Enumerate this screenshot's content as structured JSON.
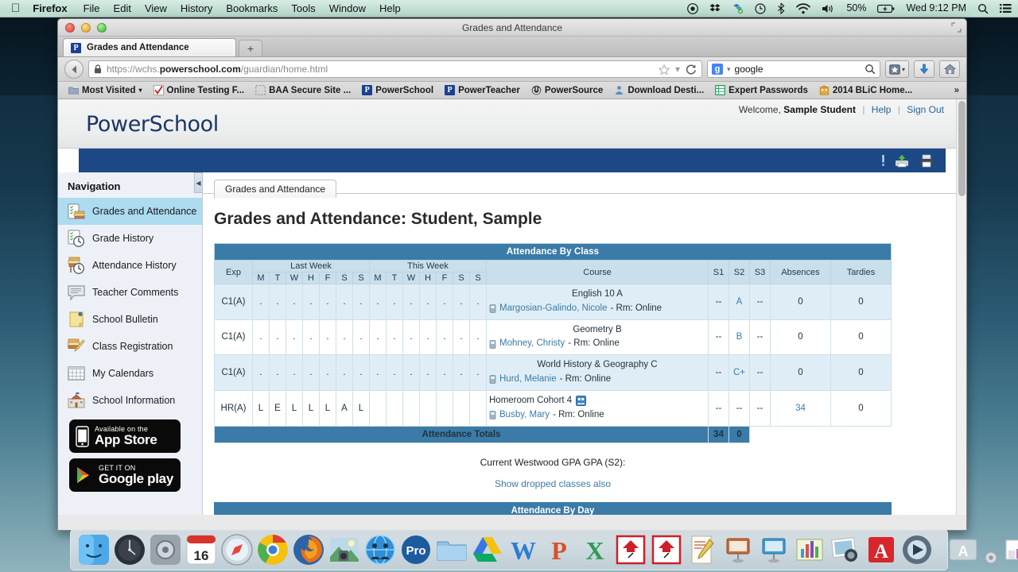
{
  "menubar": {
    "apple_icon": "apple-logo-icon",
    "items": [
      "Firefox",
      "File",
      "Edit",
      "View",
      "History",
      "Bookmarks",
      "Tools",
      "Window",
      "Help"
    ],
    "status": {
      "record_icon": "screen-record-icon",
      "dropbox_icon": "dropbox-icon",
      "sync_icon": "sync-icon",
      "timemachine_icon": "time-machine-icon",
      "bluetooth_icon": "bluetooth-icon",
      "wifi_icon": "wifi-icon",
      "volume_icon": "volume-icon",
      "battery_percent": "50%",
      "battery_icon": "battery-icon",
      "clock": "Wed 9:12 PM",
      "spotlight_icon": "search-icon",
      "notifications_icon": "notification-center-icon"
    }
  },
  "browser": {
    "window_title": "Grades and Attendance",
    "tab": {
      "label": "Grades and Attendance",
      "favicon": "powerschool-favicon"
    },
    "new_tab_label": "+",
    "url": {
      "scheme": "https://",
      "host_pre": "wchs.",
      "host_bold": "powerschool.com",
      "path": "/guardian/home.html",
      "lock_icon": "lock-icon"
    },
    "url_icons": {
      "bookmark_icon": "star-icon",
      "dropdown_icon": "chevron-down-icon",
      "reload_icon": "reload-icon"
    },
    "search": {
      "engine": "google-icon",
      "value": "google",
      "placeholder": "Search",
      "search_icon": "magnifier-icon"
    },
    "toolbar_buttons": [
      {
        "name": "bookmarks-button",
        "icon": "bookmark-star-icon"
      },
      {
        "name": "downloads-button",
        "icon": "download-arrow-icon"
      },
      {
        "name": "home-button",
        "icon": "home-icon"
      }
    ],
    "bookmarks": [
      {
        "label": "Most Visited",
        "icon": "folder-icon",
        "chevron": "▾"
      },
      {
        "label": "Online Testing F...",
        "icon": "checkmark-icon"
      },
      {
        "label": "BAA Secure Site ...",
        "icon": "placeholder-icon"
      },
      {
        "label": "PowerSchool",
        "icon": "powerschool-favicon"
      },
      {
        "label": "PowerTeacher",
        "icon": "powerschool-favicon"
      },
      {
        "label": "PowerSource",
        "icon": "power-icon"
      },
      {
        "label": "Download Desti...",
        "icon": "person-icon"
      },
      {
        "label": "Expert Passwords",
        "icon": "spreadsheet-icon"
      },
      {
        "label": "2014 BLiC Home...",
        "icon": "building-icon"
      }
    ],
    "bookmarks_overflow": "»"
  },
  "powerschool": {
    "logo": "PowerSchool",
    "welcome_prefix": "Welcome,",
    "user": "Sample Student",
    "help_label": "Help",
    "signout_label": "Sign Out",
    "bluebar_icons": [
      {
        "name": "alert-icon",
        "glyph": "!"
      },
      {
        "name": "printer-green-icon",
        "glyph": "print"
      },
      {
        "name": "printer-icon",
        "glyph": "print"
      }
    ],
    "navigation": {
      "title": "Navigation",
      "items": [
        {
          "label": "Grades and Attendance",
          "icon": "grades-book-icon",
          "active": true
        },
        {
          "label": "Grade History",
          "icon": "grade-history-icon",
          "active": false
        },
        {
          "label": "Attendance History",
          "icon": "attendance-history-icon",
          "active": false
        },
        {
          "label": "Teacher Comments",
          "icon": "comment-bubble-icon",
          "active": false
        },
        {
          "label": "School Bulletin",
          "icon": "bulletin-note-icon",
          "active": false
        },
        {
          "label": "Class Registration",
          "icon": "registration-pencil-icon",
          "active": false
        },
        {
          "label": "My Calendars",
          "icon": "calendar-grid-icon",
          "active": false
        },
        {
          "label": "School Information",
          "icon": "school-building-icon",
          "active": false
        }
      ],
      "badges": [
        {
          "name": "app-store-badge",
          "line1": "Available on the",
          "line2": "App Store",
          "icon": "iphone-icon"
        },
        {
          "name": "google-play-badge",
          "line1": "GET IT ON",
          "line2": "Google play",
          "icon": "play-triangle-icon"
        }
      ]
    },
    "content": {
      "tab_label": "Grades and Attendance",
      "page_title": "Grades and Attendance: Student, Sample",
      "table_caption": "Attendance By Class",
      "headers": {
        "exp": "Exp",
        "last_week": "Last Week",
        "this_week": "This Week",
        "days": [
          "M",
          "T",
          "W",
          "H",
          "F",
          "S",
          "S"
        ],
        "course": "Course",
        "s1": "S1",
        "s2": "S2",
        "s3": "S3",
        "absences": "Absences",
        "tardies": "Tardies"
      },
      "rows": [
        {
          "exp": "C1(A)",
          "last_week": [
            ".",
            ".",
            ".",
            ".",
            ".",
            ".",
            "."
          ],
          "this_week": [
            ".",
            ".",
            ".",
            ".",
            ".",
            ".",
            "."
          ],
          "course": "English 10 A",
          "teacher": "Margosian-Galindo, Nicole",
          "room": "- Rm: Online",
          "s1": "--",
          "s2": "A",
          "s3": "--",
          "absences": "0",
          "tardies": "0",
          "teacher_icon": "email-teacher-icon"
        },
        {
          "exp": "C1(A)",
          "last_week": [
            ".",
            ".",
            ".",
            ".",
            ".",
            ".",
            "."
          ],
          "this_week": [
            ".",
            ".",
            ".",
            ".",
            ".",
            ".",
            "."
          ],
          "course": "Geometry B",
          "teacher": "Mohney, Christy",
          "room": "- Rm: Online",
          "s1": "--",
          "s2": "B",
          "s3": "--",
          "absences": "0",
          "tardies": "0",
          "teacher_icon": "email-teacher-icon"
        },
        {
          "exp": "C1(A)",
          "last_week": [
            ".",
            ".",
            ".",
            ".",
            ".",
            ".",
            "."
          ],
          "this_week": [
            ".",
            ".",
            ".",
            ".",
            ".",
            ".",
            "."
          ],
          "course": "World History & Geography C",
          "teacher": "Hurd, Melanie",
          "room": "- Rm: Online",
          "s1": "--",
          "s2": "C+",
          "s3": "--",
          "absences": "0",
          "tardies": "0",
          "teacher_icon": "email-teacher-icon"
        },
        {
          "exp": "HR(A)",
          "last_week": [
            "L",
            "E",
            "L",
            "L",
            "L",
            "A",
            "L"
          ],
          "this_week": [
            "",
            "",
            "",
            "",
            "",
            "",
            ""
          ],
          "course": "Homeroom Cohort 4",
          "course_icon": "group-meeting-icon",
          "teacher": "Busby, Mary",
          "room": "- Rm: Online",
          "s1": "--",
          "s2": "--",
          "s3": "--",
          "absences": "34",
          "tardies": "0",
          "teacher_icon": "email-teacher-icon"
        }
      ],
      "totals": {
        "label": "Attendance Totals",
        "absences": "34",
        "tardies": "0"
      },
      "gpa_label": "Current Westwood GPA GPA (S2):",
      "show_dropped": "Show dropped classes also",
      "attendance_by_day": "Attendance By Day"
    }
  },
  "dock": {
    "items": [
      "finder-icon",
      "launchpad-icon",
      "system-preferences-icon",
      "calendar-icon",
      "safari-icon",
      "chrome-icon",
      "firefox-icon",
      "iphoto-icon",
      "webex-icon",
      "photoshop-icon",
      "folder-icon",
      "google-drive-icon",
      "word-icon",
      "powerpoint-icon",
      "excel-icon",
      "screenflow-icon",
      "screenflow-2-icon",
      "textedit-icon",
      "keynote-icon",
      "keynote-2-icon",
      "numbers-icon",
      "iphoto-2-icon",
      "acrobat-icon",
      "quicktime-icon",
      "app-store-icon",
      "settings-small-icon",
      "stickies-icon",
      "pages-doc-icon",
      "preview-doc-icon",
      "trash-icon"
    ]
  }
}
